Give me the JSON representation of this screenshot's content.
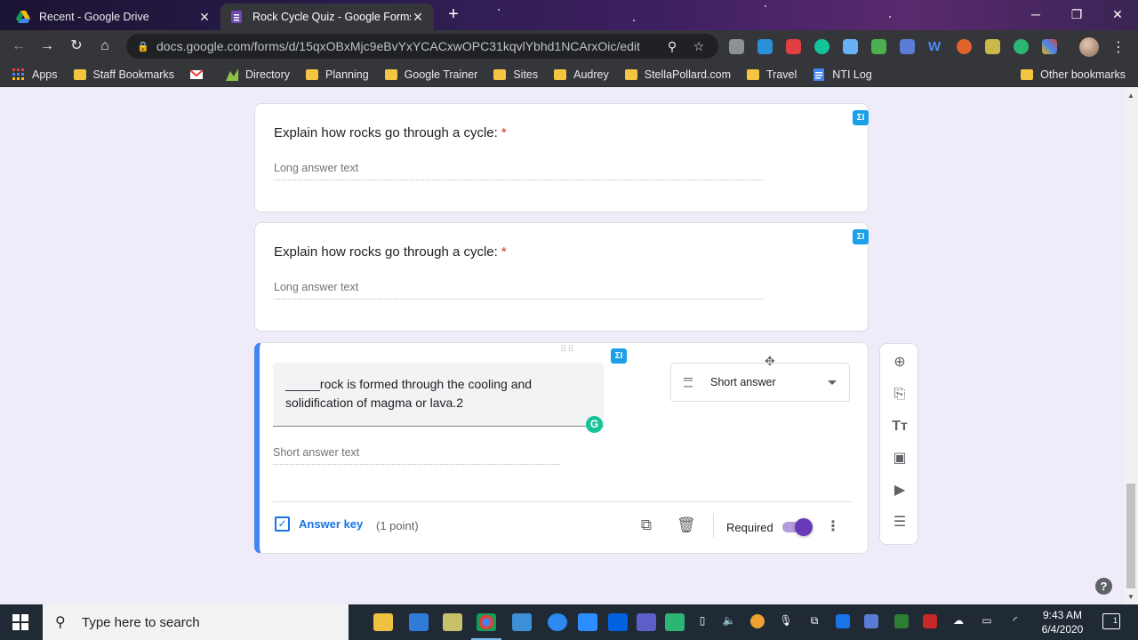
{
  "browser": {
    "tabs": [
      {
        "title": "Recent - Google Drive",
        "close": "✕"
      },
      {
        "title": "Rock Cycle Quiz - Google Forms",
        "close": "✕"
      }
    ],
    "new_tab": "+",
    "window_controls": {
      "minimize": "─",
      "restore": "❐",
      "close": "✕"
    },
    "url": "docs.google.com/forms/d/15qxOBxMjc9eBvYxYCACxwOPC31kqvlYbhd1NCArxOic/edit",
    "bookmarks": [
      {
        "label": "Apps",
        "icon": "apps-grid-icon"
      },
      {
        "label": "Staff Bookmarks",
        "icon": "folder-icon"
      },
      {
        "label": "",
        "icon": "gmail-icon"
      },
      {
        "label": "Directory",
        "icon": "directory-icon"
      },
      {
        "label": "Planning",
        "icon": "folder-icon"
      },
      {
        "label": "Google Trainer",
        "icon": "folder-icon"
      },
      {
        "label": "Sites",
        "icon": "folder-icon"
      },
      {
        "label": "Audrey",
        "icon": "folder-icon"
      },
      {
        "label": "StellaPollard.com",
        "icon": "folder-icon"
      },
      {
        "label": "Travel",
        "icon": "folder-icon"
      },
      {
        "label": "NTI Log",
        "icon": "docs-icon"
      }
    ],
    "other_bookmarks": "Other bookmarks"
  },
  "form": {
    "questions": [
      {
        "title": "Explain how rocks go through a cycle:",
        "required_mark": "*",
        "answer_placeholder": "Long answer text"
      },
      {
        "title": "Explain how rocks go through a cycle:",
        "required_mark": "*",
        "answer_placeholder": "Long answer text"
      }
    ],
    "active_question": {
      "title_line1": "_____rock is formed through the cooling and",
      "title_line2": "solidification of magma or lava.2",
      "type": "Short answer",
      "answer_placeholder": "Short answer text",
      "answer_key_label": "Answer key",
      "points": "(1 point)",
      "required_label": "Required",
      "required": true
    },
    "badge_text": "ΣI",
    "grammarly_letter": "G",
    "help": "?"
  },
  "taskbar": {
    "search_placeholder": "Type here to search",
    "time": "9:43 AM",
    "date": "6/4/2020",
    "notifications": "1"
  },
  "colors": {
    "page_background": "#f0ebf8",
    "accent_purple": "#673ab7",
    "active_card_border": "#4285f4",
    "required_star": "#d93025",
    "badge_blue": "#1a9fe8"
  }
}
